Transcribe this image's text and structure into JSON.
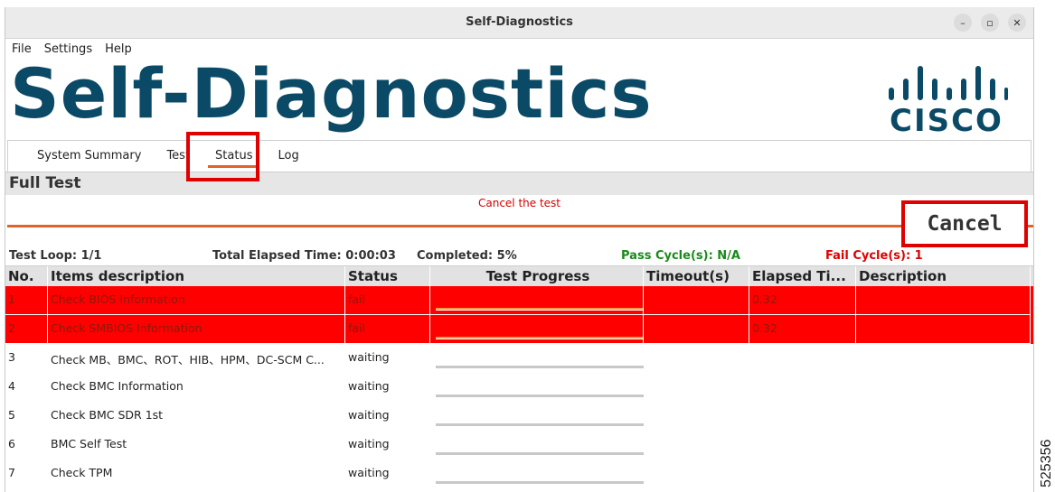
{
  "window": {
    "title": "Self-Diagnostics"
  },
  "menu": [
    "File",
    "Settings",
    "Help"
  ],
  "banner": {
    "heading": "Self-Diagnostics",
    "logo_text": "CISCO"
  },
  "tabs": [
    "System Summary",
    "Test",
    "Status",
    "Log"
  ],
  "active_tab": "Status",
  "section_title": "Full Test",
  "cancel_message": "Cancel the test",
  "cancel_button": "Cancel",
  "stats": {
    "test_loop": "Test Loop: 1/1",
    "elapsed": "Total Elapsed Time: 0:00:03",
    "completed": "Completed: 5%",
    "pass": "Pass Cycle(s): N/A",
    "fail": "Fail Cycle(s): 1"
  },
  "columns": [
    "No.",
    "Items description",
    "Status",
    "Test Progress",
    "Timeout(s)",
    "Elapsed Ti...",
    "Description"
  ],
  "rows": [
    {
      "no": "1",
      "item": "Check BIOS Information",
      "status": "fail",
      "timeout": "",
      "elapsed": "0.32",
      "desc": ""
    },
    {
      "no": "2",
      "item": "Check SMBIOS Information",
      "status": "fail",
      "timeout": "",
      "elapsed": "0.32",
      "desc": ""
    },
    {
      "no": "3",
      "item": "Check MB、BMC、ROT、HIB、HPM、DC-SCM C...",
      "status": "waiting",
      "timeout": "",
      "elapsed": "",
      "desc": ""
    },
    {
      "no": "4",
      "item": "Check BMC Information",
      "status": "waiting",
      "timeout": "",
      "elapsed": "",
      "desc": ""
    },
    {
      "no": "5",
      "item": "Check BMC SDR 1st",
      "status": "waiting",
      "timeout": "",
      "elapsed": "",
      "desc": ""
    },
    {
      "no": "6",
      "item": "BMC Self Test",
      "status": "waiting",
      "timeout": "",
      "elapsed": "",
      "desc": ""
    },
    {
      "no": "7",
      "item": "Check TPM",
      "status": "waiting",
      "timeout": "",
      "elapsed": "",
      "desc": ""
    }
  ],
  "figure_id": "525356",
  "colors": {
    "brand": "#0b4a66",
    "fail_row": "#ff0000",
    "accent": "#e2622a",
    "highlight": "#e10000"
  }
}
